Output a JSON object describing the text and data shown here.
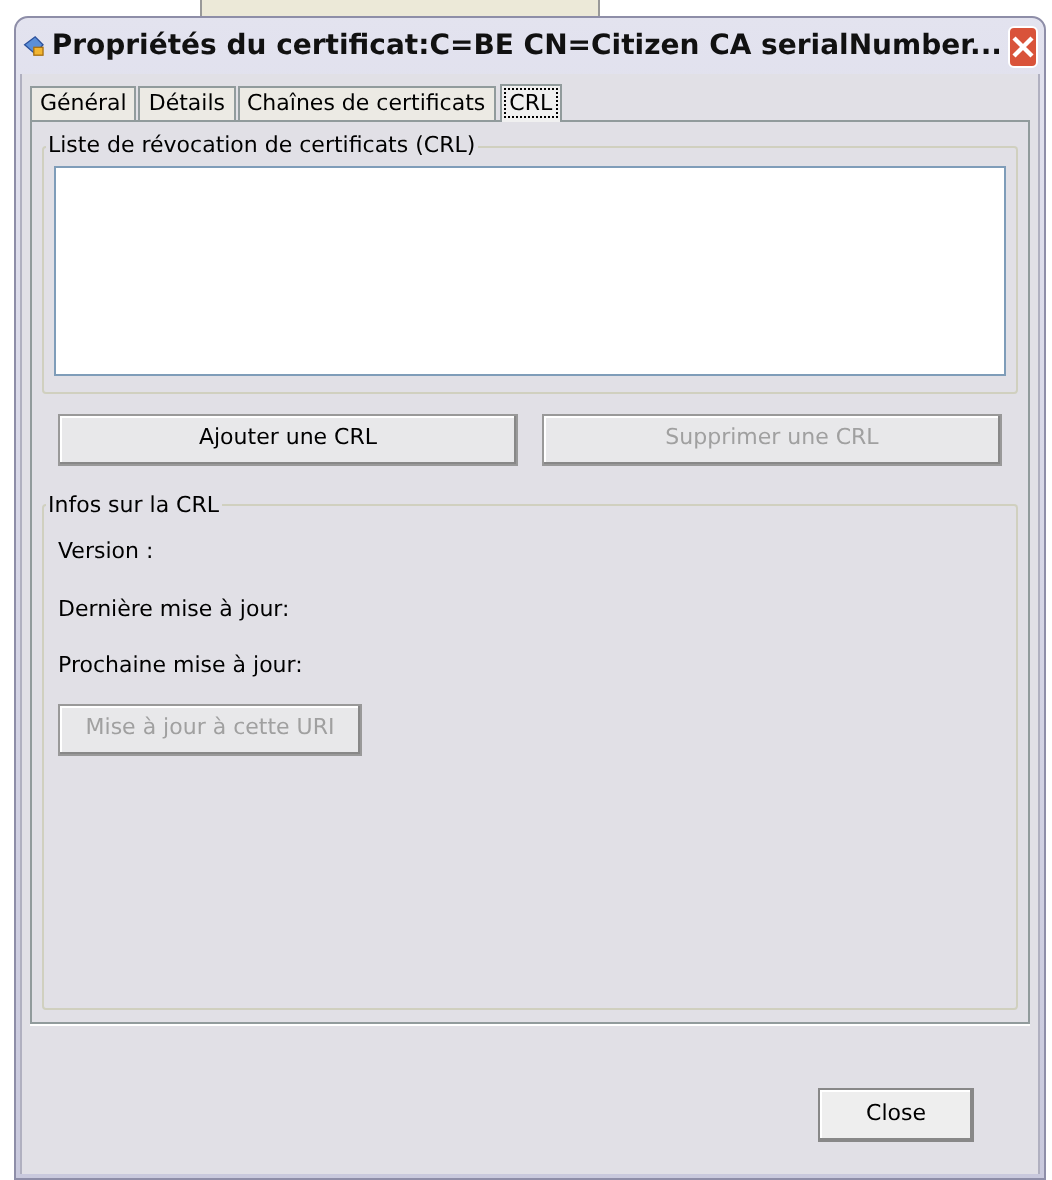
{
  "window": {
    "title": "Propriétés du certificat:C=BE CN=Citizen CA serialNumber..."
  },
  "tabs": [
    {
      "label": "Général",
      "selected": false
    },
    {
      "label": "Détails",
      "selected": false
    },
    {
      "label": "Chaînes de certificats",
      "selected": false
    },
    {
      "label": "CRL",
      "selected": true
    }
  ],
  "crl_list": {
    "title": "Liste de révocation de certificats (CRL)"
  },
  "list_buttons": [
    {
      "label": "Ajouter une CRL",
      "disabled": false
    },
    {
      "label": "Supprimer une CRL",
      "disabled": true
    }
  ],
  "crl_info": {
    "title": "Infos sur la CRL",
    "fields": [
      "Version :",
      "Dernière mise à jour:",
      "Prochaine mise à jour:"
    ],
    "update_button": {
      "label": "Mise à jour à cette URI",
      "disabled": true
    }
  },
  "close_button": {
    "label": "Close"
  }
}
